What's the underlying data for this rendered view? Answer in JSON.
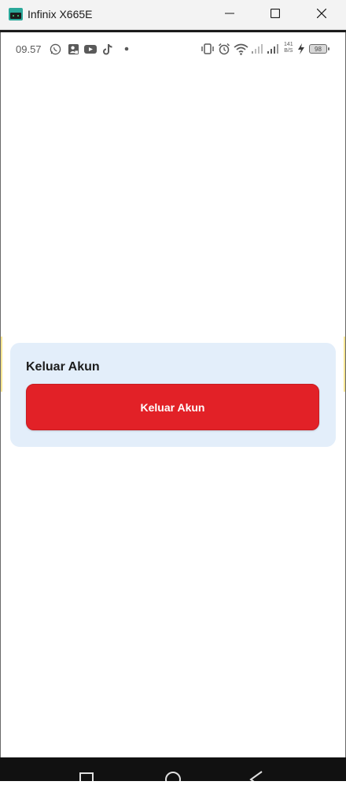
{
  "window": {
    "title": "Infinix X665E",
    "icons": [
      "android-emulator-icon",
      "minimize-icon",
      "maximize-icon",
      "close-icon"
    ]
  },
  "status_bar": {
    "time": "09.57",
    "left_icons": [
      "whatsapp-icon",
      "contact-card-icon",
      "youtube-icon",
      "tiktok-icon",
      "dot-icon"
    ],
    "right_icons": [
      "vibrate-icon",
      "alarm-icon",
      "wifi-icon",
      "signal-weak-icon",
      "signal-icon",
      "charging-icon"
    ],
    "network_speed": "141\nB/S",
    "battery": "98"
  },
  "card": {
    "title": "Keluar Akun",
    "button_label": "Keluar Akun"
  },
  "nav_bar": {
    "icons": [
      "recents-icon",
      "home-icon",
      "back-icon"
    ]
  },
  "colors": {
    "card_bg": "#e3eefa",
    "button_bg": "#e22127",
    "navbar_bg": "#111111"
  }
}
